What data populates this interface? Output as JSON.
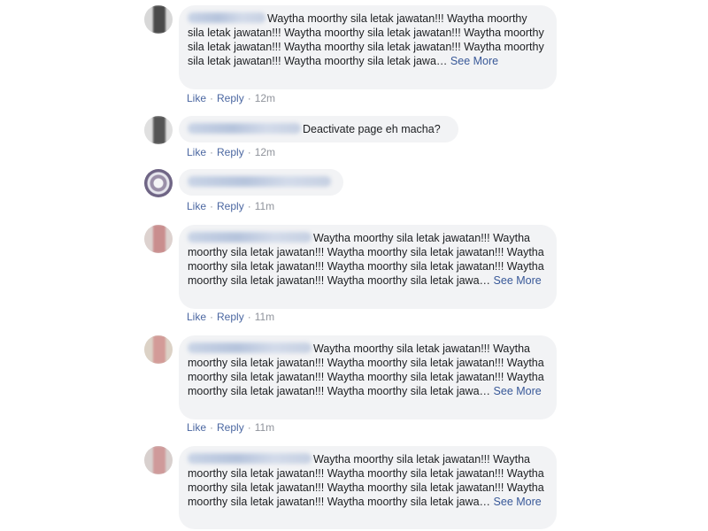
{
  "comments": [
    {
      "text": "Waytha moorthy sila letak jawatan!!! Waytha moorthy sila letak jawatan!!! Waytha moorthy sila letak jawatan!!! Waytha moorthy sila letak jawatan!!! Waytha moorthy sila letak jawatan!!! Waytha moorthy sila letak jawatan!!! Waytha moorthy sila letak jawa…",
      "see_more": "See More",
      "like": "Like",
      "reply": "Reply",
      "time": "12m",
      "dot": "·"
    },
    {
      "text": "Deactivate page eh macha?",
      "like": "Like",
      "reply": "Reply",
      "time": "12m",
      "dot": "·"
    },
    {
      "text": "",
      "like": "Like",
      "reply": "Reply",
      "time": "11m",
      "dot": "·"
    },
    {
      "text": "Waytha moorthy sila letak jawatan!!! Waytha moorthy sila letak jawatan!!! Waytha moorthy sila letak jawatan!!! Waytha moorthy sila letak jawatan!!! Waytha moorthy sila letak jawatan!!! Waytha moorthy sila letak jawatan!!! Waytha moorthy sila letak jawa…",
      "see_more": "See More",
      "like": "Like",
      "reply": "Reply",
      "time": "11m",
      "dot": "·"
    },
    {
      "text": "Waytha moorthy sila letak jawatan!!! Waytha moorthy sila letak jawatan!!! Waytha moorthy sila letak jawatan!!! Waytha moorthy sila letak jawatan!!! Waytha moorthy sila letak jawatan!!! Waytha moorthy sila letak jawatan!!! Waytha moorthy sila letak jawa…",
      "see_more": "See More",
      "like": "Like",
      "reply": "Reply",
      "time": "11m",
      "dot": "·"
    },
    {
      "text": "Waytha moorthy sila letak jawatan!!! Waytha moorthy sila letak jawatan!!! Waytha moorthy sila letak jawatan!!! Waytha moorthy sila letak jawatan!!! Waytha moorthy sila letak jawatan!!! Waytha moorthy sila letak jawatan!!! Waytha moorthy sila letak jawa…",
      "see_more": "See More"
    }
  ],
  "colors": {
    "bubble_bg": "#f2f3f5",
    "link_blue": "#385898",
    "action_blue": "#4b67a1",
    "meta_gray": "#90949c",
    "text": "#1c1e21"
  }
}
